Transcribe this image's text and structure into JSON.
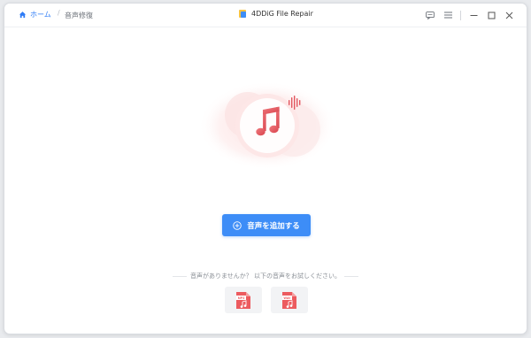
{
  "breadcrumb": {
    "home_label": "ホーム",
    "current_label": "音声修復"
  },
  "app": {
    "title": "4DDiG File Repair"
  },
  "main": {
    "add_button_label": "音声を追加する",
    "sample_prompt": "音声がありませんか？ 以下の音声をお試しください。",
    "sample_files": [
      {
        "format": "MP3",
        "icon": "mp3-file-icon"
      },
      {
        "format": "WAV",
        "icon": "wav-file-icon"
      }
    ]
  },
  "colors": {
    "accent": "#3d8df7",
    "music_note": "#e2565f",
    "glow": "#fbdcdc"
  }
}
